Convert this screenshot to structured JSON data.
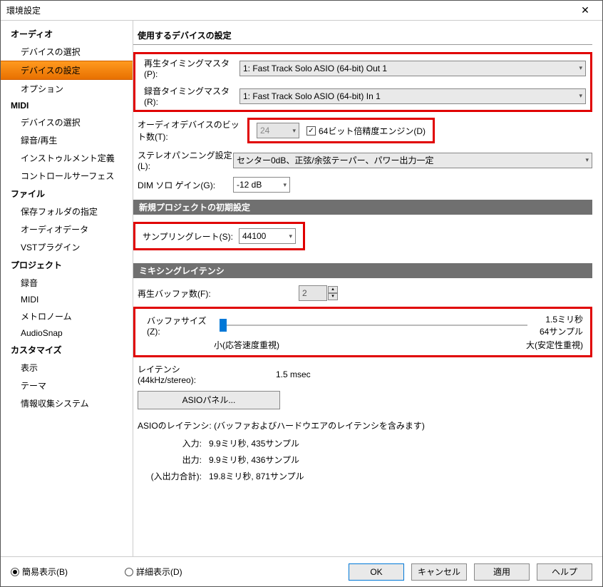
{
  "window": {
    "title": "環境設定"
  },
  "sidebar": {
    "sections": [
      {
        "label": "オーディオ",
        "items": [
          "デバイスの選択",
          "デバイスの設定",
          "オプション"
        ]
      },
      {
        "label": "MIDI",
        "items": [
          "デバイスの選択",
          "録音/再生",
          "インストゥルメント定義",
          "コントロールサーフェス"
        ]
      },
      {
        "label": "ファイル",
        "items": [
          "保存フォルダの指定",
          "オーディオデータ",
          "VSTプラグイン"
        ]
      },
      {
        "label": "プロジェクト",
        "items": [
          "録音",
          "MIDI",
          "メトロノーム",
          "AudioSnap"
        ]
      },
      {
        "label": "カスタマイズ",
        "items": [
          "表示",
          "テーマ",
          "情報収集システム"
        ]
      }
    ],
    "selected": "デバイスの設定"
  },
  "main": {
    "heading": "使用するデバイスの設定",
    "playback_label": "再生タイミングマスタ(P):",
    "playback_value": "1: Fast Track Solo ASIO (64-bit) Out 1",
    "record_label": "録音タイミングマスタ(R):",
    "record_value": "1: Fast Track Solo ASIO (64-bit) In 1",
    "bitdepth_label": "オーディオデバイスのビット数(T):",
    "bitdepth_value": "24",
    "engine64_label": "64ビット倍精度エンジン(D)",
    "panning_label": "ステレオパンニング設定(L):",
    "panning_value": "センター0dB、正弦/余弦テーパー、パワー出力一定",
    "dim_label": "DIM ソロ ゲイン(G):",
    "dim_value": "-12 dB",
    "newproj_bar": "新規プロジェクトの初期設定",
    "samplerate_label": "サンプリングレート(S):",
    "samplerate_value": "44100",
    "mixing_bar": "ミキシングレイテンシ",
    "buffers_label": "再生バッファ数(F):",
    "buffers_value": "2",
    "bufsize_label": "バッファサイズ(Z):",
    "bufsize_ms": "1.5ミリ秒",
    "bufsize_samples": "64サンプル",
    "bufsize_small": "小(応答速度重視)",
    "bufsize_large": "大(安定性重視)",
    "latency_label": "レイテンシ(44kHz/stereo):",
    "latency_value": "1.5 msec",
    "asio_panel": "ASIOパネル...",
    "asio_latency_label": "ASIOのレイテンシ: (バッファおよびハードウエアのレイテンシを含みます)",
    "in_label": "入力:",
    "in_value": "9.9ミリ秒, 435サンプル",
    "out_label": "出力:",
    "out_value": "9.9ミリ秒, 436サンプル",
    "total_label": "(入出力合計):",
    "total_value": "19.8ミリ秒, 871サンプル"
  },
  "footer": {
    "simple": "簡易表示(B)",
    "detail": "詳細表示(D)",
    "ok": "OK",
    "cancel": "キャンセル",
    "apply": "適用",
    "help": "ヘルプ"
  }
}
